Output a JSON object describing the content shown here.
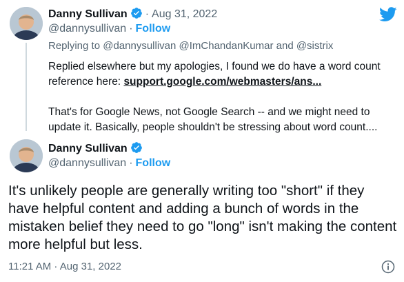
{
  "colors": {
    "brand_blue": "#1d9bf0",
    "muted": "#536471",
    "text": "#0f1419"
  },
  "quoted_tweet": {
    "author_name": "Danny Sullivan",
    "date": "Aug 31, 2022",
    "handle": "@dannysullivan",
    "follow_label": "Follow",
    "reply_prefix": "Replying to",
    "reply_handles": "@dannysullivan @ImChandanKumar and @sistrix",
    "text_paragraph_1": "Replied elsewhere but my apologies, I found we do have a word count reference here:",
    "link_text": "support.google.com/webmasters/ans...",
    "text_paragraph_2": "That's for Google News, not Google Search -- and we might need to update it. Basically, people shouldn't be stressing about word count...."
  },
  "main_tweet": {
    "author_name": "Danny Sullivan",
    "handle": "@dannysullivan",
    "follow_label": "Follow",
    "text": "It's unlikely people are generally writing too \"short\" if they have helpful content and adding a bunch of words in the mistaken belief they need to go \"long\" isn't making the content more helpful but less.",
    "timestamp": "11:21 AM · Aug 31, 2022"
  },
  "icons": {
    "logo": "twitter-bird-icon",
    "verified": "verified-badge-icon",
    "info": "info-icon"
  }
}
